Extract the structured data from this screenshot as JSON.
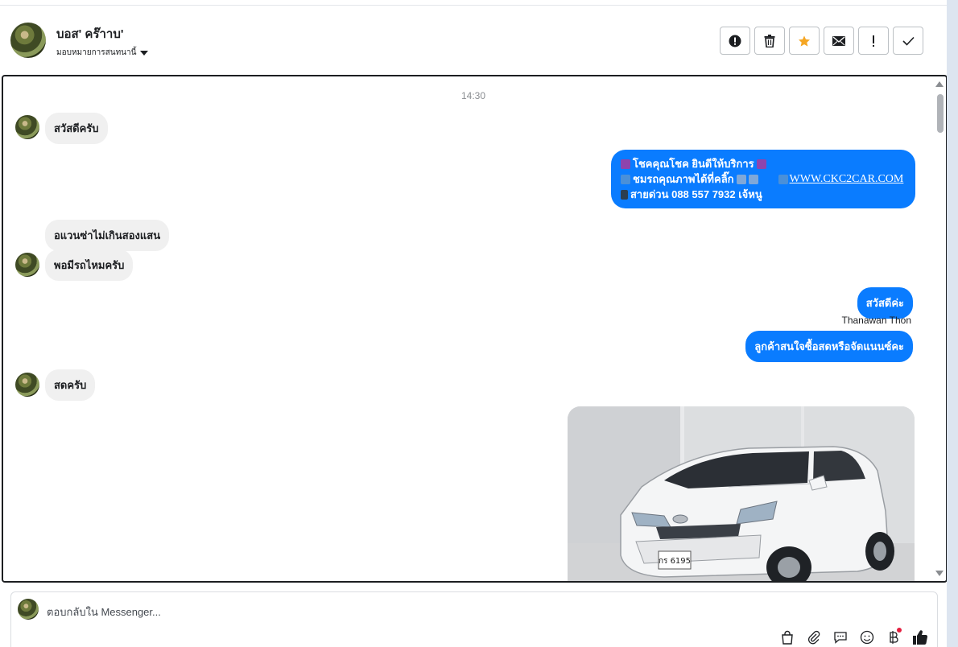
{
  "header": {
    "contact_name": "บอส' คร๊าาบ'",
    "assign_label": "มอบหมายการสนทนานี้",
    "actions": [
      {
        "icon": "alert-circle-icon",
        "name": "spam-button"
      },
      {
        "icon": "trash-icon",
        "name": "delete-button"
      },
      {
        "icon": "star-icon",
        "name": "star-button",
        "color": "#f5a623"
      },
      {
        "icon": "mail-icon",
        "name": "mark-unread-button"
      },
      {
        "icon": "exclamation-icon",
        "name": "follow-up-button"
      },
      {
        "icon": "check-icon",
        "name": "done-button"
      }
    ]
  },
  "conversation": {
    "timestamp": "14:30",
    "incoming": [
      {
        "text": "สวัสดีครับ"
      },
      {
        "text": "อแวนซ่าไม่เกินสองแสน"
      },
      {
        "text": "พอมีรถไหมครับ"
      },
      {
        "text": "สดครับ"
      }
    ],
    "promo": {
      "line1": "โชคคุณโชค ยินดีให้บริการ",
      "line2": "ชมรถคุณภาพได้ที่คลิ๊ก",
      "link": "WWW.CKC2CAR.COM",
      "line3": "สายด่วน 088 557 7932 เจ้หนู"
    },
    "outgoing": [
      {
        "text": "สวัสดีค่ะ"
      },
      {
        "text": "ลูกค้าสนใจซื้อสดหรือจัดแนนซ์คะ"
      }
    ],
    "sender_name": "Thanawan Thon",
    "photo_plate": "กร 6195"
  },
  "composer": {
    "placeholder": "ตอบกลับใน Messenger..."
  },
  "colors": {
    "accent": "#0a7cff",
    "incoming_bubble": "#f0f0f0",
    "star": "#f5a623",
    "badge": "#e41e3f"
  }
}
